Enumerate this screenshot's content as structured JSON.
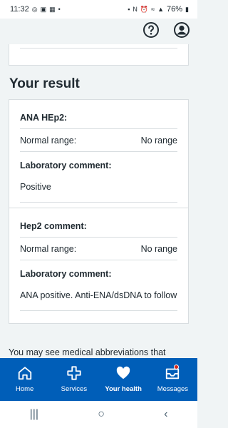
{
  "status_bar": {
    "time": "11:32",
    "battery": "76%"
  },
  "header": {
    "help_icon": "question-circle-icon",
    "account_icon": "account-icon"
  },
  "main": {
    "section_title": "Your result",
    "results": [
      {
        "name": "ANA HEp2:",
        "range_label": "Normal range:",
        "range_value": "No range",
        "comment_label": "Laboratory comment:",
        "comment_text": "Positive"
      },
      {
        "name": "Hep2 comment:",
        "range_label": "Normal range:",
        "range_value": "No range",
        "comment_label": "Laboratory comment:",
        "comment_text": "ANA positive. Anti-ENA/dsDNA to follow"
      }
    ],
    "footer_text": "You may see medical abbreviations that"
  },
  "tab_bar": {
    "tabs": [
      {
        "label": "Home",
        "icon": "home-icon"
      },
      {
        "label": "Services",
        "icon": "cross-icon"
      },
      {
        "label": "Your health",
        "icon": "heart-icon"
      },
      {
        "label": "Messages",
        "icon": "messages-icon"
      }
    ],
    "active": "Your health",
    "brand_color": "#005eb8"
  },
  "nav_bar": {
    "recent": "|||",
    "home": "○",
    "back": "‹"
  }
}
